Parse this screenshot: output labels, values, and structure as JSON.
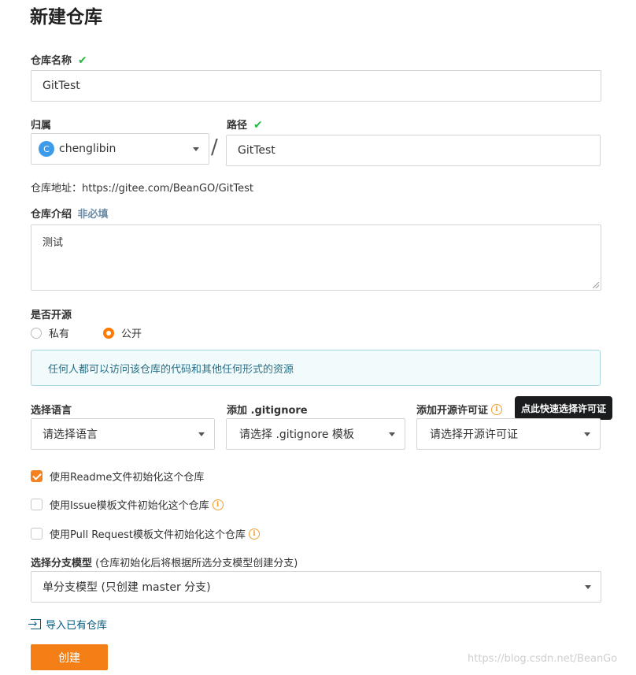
{
  "page_title": "新建仓库",
  "repo_name": {
    "label": "仓库名称",
    "value": "GitTest"
  },
  "owner": {
    "label": "归属",
    "avatar_letter": "C",
    "value": "chenglibin"
  },
  "separator": "/",
  "path": {
    "label": "路径",
    "value": "GitTest"
  },
  "repo_address": "仓库地址：https://gitee.com/BeanGO/GitTest",
  "description": {
    "label": "仓库介绍",
    "optional": "非必填",
    "value": "测试"
  },
  "visibility": {
    "label": "是否开源",
    "options": [
      "私有",
      "公开"
    ],
    "selected": "公开",
    "notice": "任何人都可以访问该仓库的代码和其他任何形式的资源"
  },
  "language": {
    "label": "选择语言",
    "placeholder": "请选择语言"
  },
  "gitignore": {
    "label": "添加 .gitignore",
    "placeholder": "请选择 .gitignore 模板"
  },
  "license": {
    "label": "添加开源许可证",
    "placeholder": "请选择开源许可证",
    "tooltip": "点此快速选择许可证"
  },
  "init_options": [
    {
      "label": "使用Readme文件初始化这个仓库",
      "checked": true
    },
    {
      "label": "使用Issue模板文件初始化这个仓库",
      "checked": false
    },
    {
      "label": "使用Pull Request模板文件初始化这个仓库",
      "checked": false
    }
  ],
  "branch_model": {
    "label": "选择分支模型",
    "hint": "(仓库初始化后将根据所选分支模型创建分支)",
    "value": "单分支模型 (只创建 master 分支)"
  },
  "import_link": "导入已有仓库",
  "create_button": "创建",
  "watermark": "https://blog.csdn.net/BeanGo",
  "colors": {
    "accent": "#f57f17",
    "check": "#21ba45",
    "notice_bg": "#f2fbfc",
    "notice_border": "#a9d5de",
    "notice_text": "#276f86"
  }
}
